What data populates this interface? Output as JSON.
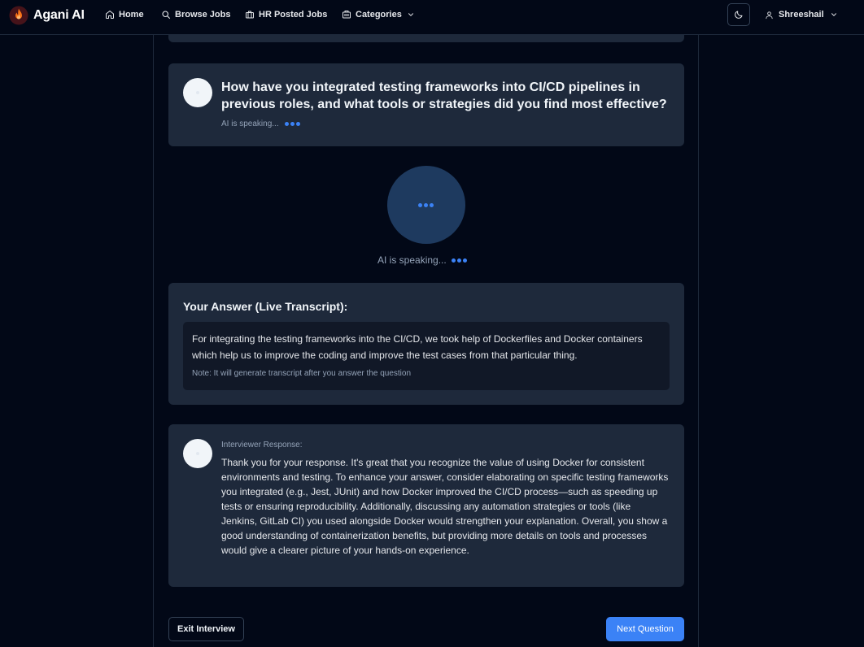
{
  "app": {
    "name": "Agani AI"
  },
  "nav": {
    "home": "Home",
    "browse_jobs": "Browse Jobs",
    "hr_posted_jobs": "HR Posted Jobs",
    "categories": "Categories"
  },
  "user": {
    "name": "Shreeshail"
  },
  "question": {
    "text": "How have you integrated testing frameworks into CI/CD pipelines in previous roles, and what tools or strategies did you find most effective?",
    "status": "AI is speaking..."
  },
  "speaker": {
    "status": "AI is speaking..."
  },
  "answer": {
    "title": "Your Answer (Live Transcript):",
    "transcript": "For integrating the testing frameworks into the CI/CD, we took help of Dockerfiles and Docker containers which help us to improve the coding and improve the test cases from that particular thing.",
    "note": "Note: It will generate transcript after you answer the question"
  },
  "response": {
    "label": "Interviewer Response:",
    "text": "Thank you for your response. It's great that you recognize the value of using Docker for consistent environments and testing. To enhance your answer, consider elaborating on specific testing frameworks you integrated (e.g., Jest, JUnit) and how Docker improved the CI/CD process—such as speeding up tests or ensuring reproducibility. Additionally, discussing any automation strategies or tools (like Jenkins, GitLab CI) you used alongside Docker would strengthen your explanation. Overall, you show a good understanding of containerization benefits, but providing more details on tools and processes would give a clearer picture of your hands-on experience."
  },
  "actions": {
    "exit": "Exit Interview",
    "next": "Next Question"
  },
  "colors": {
    "background": "#020817",
    "card": "#1e293b",
    "accent": "#3b82f6",
    "speaker_circle": "#1e3a5f"
  },
  "icons": {
    "logo": "flame-icon",
    "home": "home-icon",
    "browse": "search-icon",
    "hr_jobs": "briefcase-icon",
    "categories": "building-icon",
    "theme": "moon-icon",
    "user": "user-icon",
    "chevron": "chevron-down-icon"
  }
}
